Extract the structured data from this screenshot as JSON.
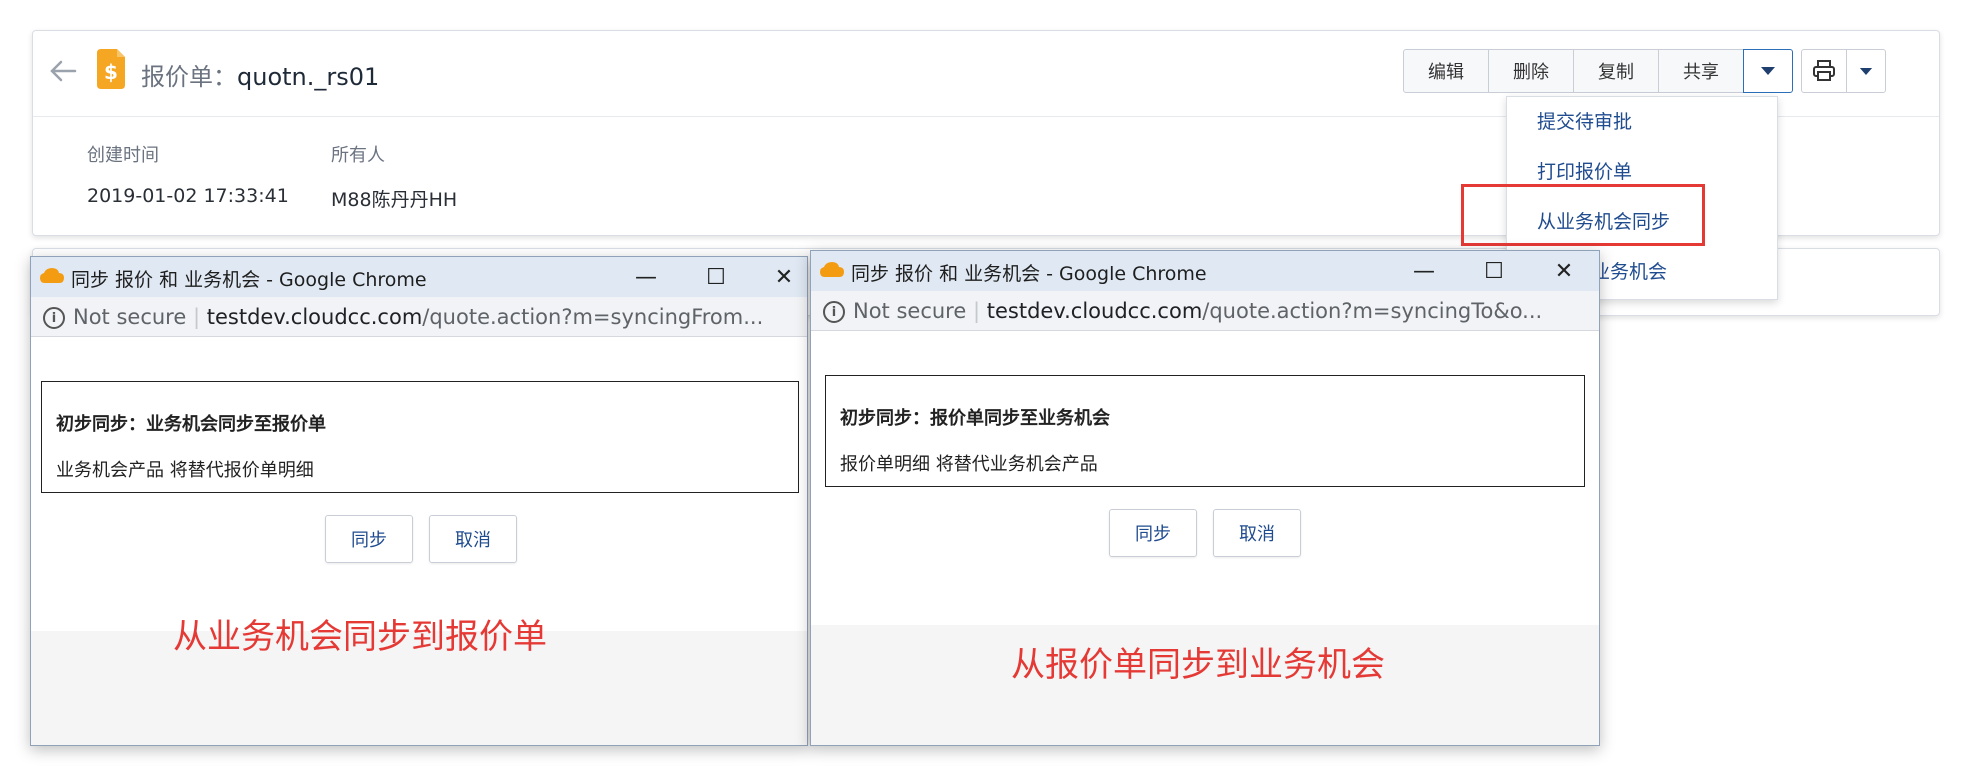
{
  "record": {
    "title_prefix": "报价单：",
    "title_name": "quotn._rs01",
    "icon": "dollar-document-icon",
    "fields": [
      {
        "label": "创建时间",
        "value": "2019-01-02 17:33:41"
      },
      {
        "label": "所有人",
        "value": "M88陈丹丹HH"
      }
    ]
  },
  "toolbar": {
    "edit": "编辑",
    "delete": "删除",
    "copy": "复制",
    "share": "共享",
    "more_icon": "caret-down-icon",
    "print_icon": "printer-icon"
  },
  "dropdown": {
    "items": [
      "提交待审批",
      "打印报价单",
      "从业务机会同步",
      "同步到业务机会"
    ],
    "visible_items": [
      "提交待审批",
      "打印报价单",
      "从业务机会同步",
      "业务机会"
    ],
    "highlighted": "从业务机会同步"
  },
  "window1": {
    "title": "同步 报价 和 业务机会 - Google Chrome",
    "security": "Not secure",
    "url_domain": "testdev.cloudcc.com",
    "url_path": "/quote.action?m=syncingFrom...",
    "heading": "初步同步：业务机会同步至报价单",
    "message": "业务机会产品 将替代报价单明细",
    "sync_button": "同步",
    "cancel_button": "取消",
    "caption": "从业务机会同步到报价单"
  },
  "window2": {
    "title": "同步 报价 和 业务机会 - Google Chrome",
    "security": "Not secure",
    "url_domain": "testdev.cloudcc.com",
    "url_path": "/quote.action?m=syncingTo&o...",
    "heading": "初步同步：报价单同步至业务机会",
    "message": "报价单明细 将替代业务机会产品",
    "sync_button": "同步",
    "cancel_button": "取消",
    "caption": "从报价单同步到业务机会"
  },
  "window_controls": {
    "minimize": "—",
    "maximize": "☐",
    "close": "✕"
  },
  "colors": {
    "accent_red": "#e53935",
    "link_blue": "#1f4b8f",
    "titlebar": "#dfe8f3"
  }
}
